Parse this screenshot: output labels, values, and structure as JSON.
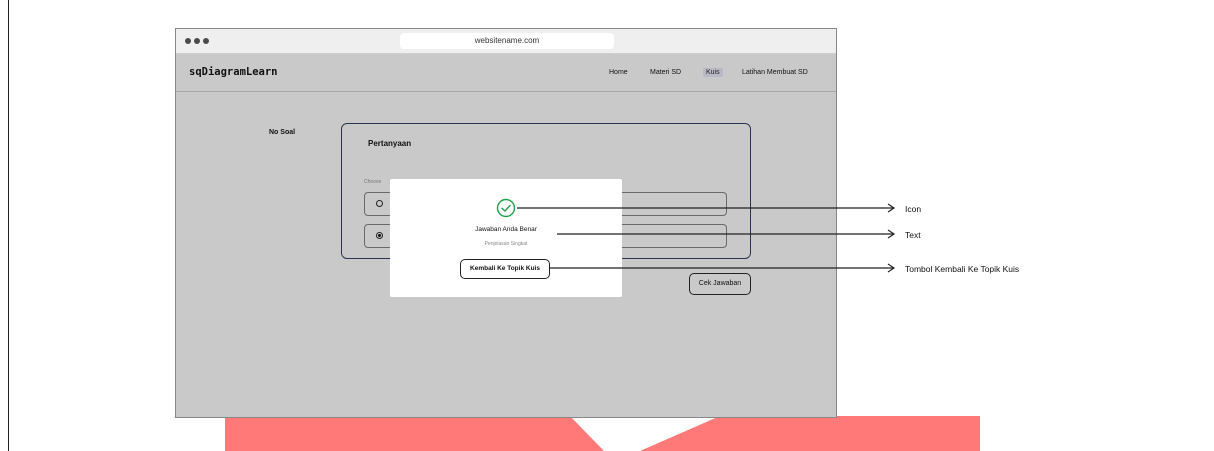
{
  "browser": {
    "url": "websitename.com"
  },
  "nav": {
    "brand": "sqDiagramLearn",
    "links": [
      "Home",
      "Materi SD",
      "Kuis",
      "Latihan Membuat SD"
    ],
    "active": "Kuis"
  },
  "quiz": {
    "no_soal_label": "No Soal",
    "question_title": "Pertanyaan",
    "choose_label": "Choose",
    "check_button": "Cek Jawaban",
    "selected_option_index": 1
  },
  "modal": {
    "title": "Jawaban Anda Benar",
    "subtitle": "Penjelasan Singkat",
    "back_button": "Kembali Ke Topik Kuis",
    "icon": "check-circle-icon",
    "icon_color": "#22a04a"
  },
  "annotations": {
    "icon_label": "Icon",
    "text_label": "Text",
    "button_label": "Tombol Kembali Ke Topik Kuis"
  },
  "colors": {
    "watermark_red": "#ff6464",
    "card_border": "#2c3350",
    "page_bg": "#c9c9c9"
  }
}
